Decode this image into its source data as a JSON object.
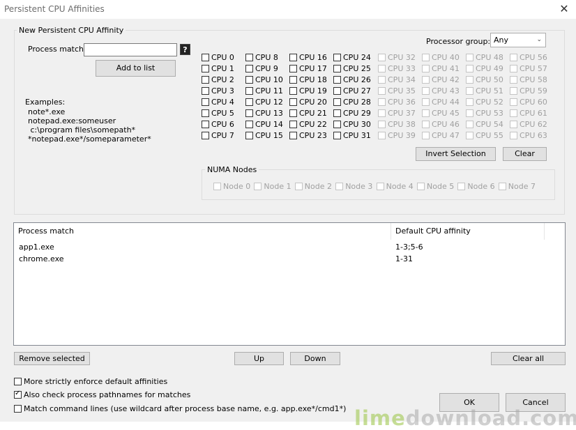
{
  "window": {
    "title": "Persistent CPU Affinities"
  },
  "new_affinity": {
    "group_label": "New Persistent CPU Affinity",
    "process_match_label": "Process match:",
    "process_match_value": "",
    "help_glyph": "?",
    "add_button": "Add to list",
    "examples_title": "Examples:",
    "examples": [
      "note*.exe",
      "notepad.exe:someuser",
      " c:\\program files\\somepath*",
      "*notepad.exe*/someparameter*"
    ],
    "processor_group_label": "Processor group:",
    "processor_group_value": "Any",
    "cpus": [
      "CPU 0",
      "CPU 1",
      "CPU 2",
      "CPU 3",
      "CPU 4",
      "CPU 5",
      "CPU 6",
      "CPU 7",
      "CPU 8",
      "CPU 9",
      "CPU 10",
      "CPU 11",
      "CPU 12",
      "CPU 13",
      "CPU 14",
      "CPU 15",
      "CPU 16",
      "CPU 17",
      "CPU 18",
      "CPU 19",
      "CPU 20",
      "CPU 21",
      "CPU 22",
      "CPU 23",
      "CPU 24",
      "CPU 25",
      "CPU 26",
      "CPU 27",
      "CPU 28",
      "CPU 29",
      "CPU 30",
      "CPU 31",
      "CPU 32",
      "CPU 33",
      "CPU 34",
      "CPU 35",
      "CPU 36",
      "CPU 37",
      "CPU 38",
      "CPU 39",
      "CPU 40",
      "CPU 41",
      "CPU 42",
      "CPU 43",
      "CPU 44",
      "CPU 45",
      "CPU 46",
      "CPU 47",
      "CPU 48",
      "CPU 49",
      "CPU 50",
      "CPU 51",
      "CPU 52",
      "CPU 53",
      "CPU 54",
      "CPU 55",
      "CPU 56",
      "CPU 57",
      "CPU 58",
      "CPU 59",
      "CPU 60",
      "CPU 61",
      "CPU 62",
      "CPU 63"
    ],
    "enabled_cpu_count": 32,
    "invert_button": "Invert Selection",
    "clear_button": "Clear",
    "numa_label": "NUMA Nodes",
    "numa_nodes": [
      "Node 0",
      "Node 1",
      "Node 2",
      "Node 3",
      "Node 4",
      "Node 5",
      "Node 6",
      "Node 7"
    ]
  },
  "table": {
    "columns": [
      "Process match",
      "Default CPU affinity"
    ],
    "rows": [
      [
        "app1.exe",
        "1-3;5-6"
      ],
      [
        "chrome.exe",
        "1-31"
      ]
    ]
  },
  "buttons": {
    "remove": "Remove selected",
    "up": "Up",
    "down": "Down",
    "clear_all": "Clear all",
    "ok": "OK",
    "cancel": "Cancel"
  },
  "options": [
    {
      "label": "More strictly enforce default affinities",
      "checked": false
    },
    {
      "label": "Also check process pathnames for matches",
      "checked": true
    },
    {
      "label": "Match command lines (use wildcard after process base name, e.g. app.exe*/cmd1*)",
      "checked": false
    }
  ],
  "watermark": {
    "part1": "lime",
    "part2": "download.com"
  }
}
